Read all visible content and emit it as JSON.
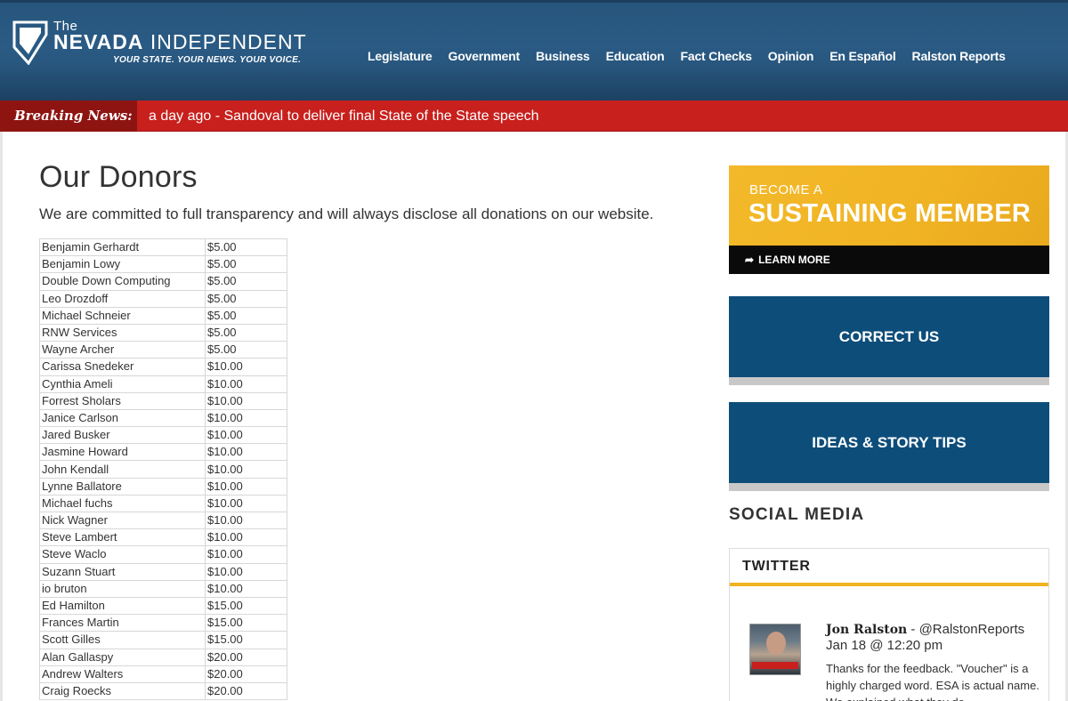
{
  "header": {
    "logo": {
      "the": "The",
      "name_bold": "NEVADA",
      "name_light": "INDEPENDENT",
      "tagline": "YOUR STATE. YOUR NEWS. YOUR VOICE."
    },
    "nav": [
      "Legislature",
      "Government",
      "Business",
      "Education",
      "Fact Checks",
      "Opinion",
      "En Español",
      "Ralston Reports"
    ]
  },
  "breaking": {
    "label": "Breaking News:",
    "text": "a day ago - Sandoval to deliver final State of the State speech"
  },
  "main": {
    "title": "Our Donors",
    "intro": "We are committed to full transparency and will always disclose all donations on our website.",
    "donors": [
      {
        "name": "Benjamin Gerhardt",
        "amount": "$5.00"
      },
      {
        "name": "Benjamin Lowy",
        "amount": "$5.00"
      },
      {
        "name": "Double Down Computing",
        "amount": "$5.00"
      },
      {
        "name": "Leo Drozdoff",
        "amount": "$5.00"
      },
      {
        "name": "Michael Schneier",
        "amount": "$5.00"
      },
      {
        "name": "RNW Services",
        "amount": "$5.00"
      },
      {
        "name": "Wayne Archer",
        "amount": "$5.00"
      },
      {
        "name": "Carissa Snedeker",
        "amount": "$10.00"
      },
      {
        "name": "Cynthia Ameli",
        "amount": "$10.00"
      },
      {
        "name": "Forrest Sholars",
        "amount": "$10.00"
      },
      {
        "name": "Janice Carlson",
        "amount": "$10.00"
      },
      {
        "name": "Jared Busker",
        "amount": "$10.00"
      },
      {
        "name": "Jasmine Howard",
        "amount": "$10.00"
      },
      {
        "name": "John Kendall",
        "amount": "$10.00"
      },
      {
        "name": "Lynne Ballatore",
        "amount": "$10.00"
      },
      {
        "name": "Michael fuchs",
        "amount": "$10.00"
      },
      {
        "name": "Nick Wagner",
        "amount": "$10.00"
      },
      {
        "name": "Steve Lambert",
        "amount": "$10.00"
      },
      {
        "name": "Steve Waclo",
        "amount": "$10.00"
      },
      {
        "name": "Suzann Stuart",
        "amount": "$10.00"
      },
      {
        "name": "io bruton",
        "amount": "$10.00"
      },
      {
        "name": "Ed Hamilton",
        "amount": "$15.00"
      },
      {
        "name": "Frances Martin",
        "amount": "$15.00"
      },
      {
        "name": "Scott Gilles",
        "amount": "$15.00"
      },
      {
        "name": "Alan Gallaspy",
        "amount": "$20.00"
      },
      {
        "name": "Andrew Walters",
        "amount": "$20.00"
      },
      {
        "name": "Craig Roecks",
        "amount": "$20.00"
      }
    ]
  },
  "sidebar": {
    "sustain": {
      "kicker": "BECOME A",
      "title": "SUSTAINING MEMBER",
      "cta": "LEARN MORE"
    },
    "correct_label": "CORRECT US",
    "ideas_label": "IDEAS & STORY TIPS",
    "social_heading": "SOCIAL MEDIA",
    "twitter": {
      "heading": "TWITTER",
      "tweet": {
        "name": "Jon Ralston",
        "handle": " - @RalstonReports",
        "date": "Jan 18 @ 12:20 pm",
        "text": "Thanks for the feedback. \"Voucher\" is a highly charged word. ESA is actual name. We explained what they do."
      }
    }
  },
  "colors": {
    "header_blue": "#2a5b84",
    "breaking_red": "#c8201d",
    "sustain_yellow": "#f0b323",
    "button_blue": "#0d4d7a"
  }
}
